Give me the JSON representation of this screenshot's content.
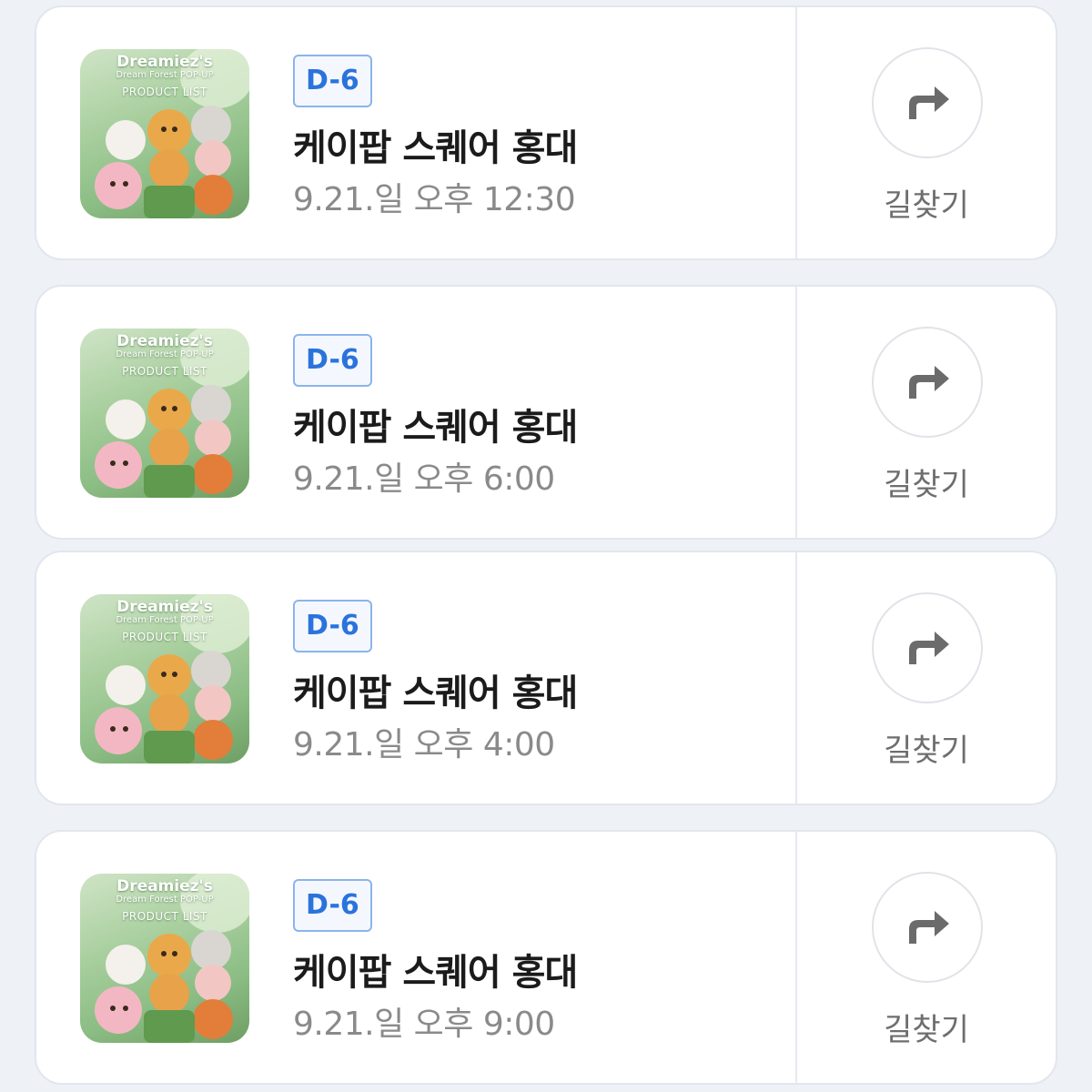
{
  "items": [
    {
      "thumb": {
        "title": "Dreamiez's",
        "subtitle": "Dream Forest POP-UP",
        "list_label": "PRODUCT LIST"
      },
      "badge": "D-6",
      "venue": "케이팝 스퀘어 홍대",
      "datetime": "9.21.일 오후 12:30",
      "action_label": "길찾기",
      "action_icon": "turn-right-arrow-icon"
    },
    {
      "thumb": {
        "title": "Dreamiez's",
        "subtitle": "Dream Forest POP-UP",
        "list_label": "PRODUCT LIST"
      },
      "badge": "D-6",
      "venue": "케이팝 스퀘어 홍대",
      "datetime": "9.21.일 오후 6:00",
      "action_label": "길찾기",
      "action_icon": "turn-right-arrow-icon"
    },
    {
      "thumb": {
        "title": "Dreamiez's",
        "subtitle": "Dream Forest POP-UP",
        "list_label": "PRODUCT LIST"
      },
      "badge": "D-6",
      "venue": "케이팝 스퀘어 홍대",
      "datetime": "9.21.일 오후 4:00",
      "action_label": "길찾기",
      "action_icon": "turn-right-arrow-icon"
    },
    {
      "thumb": {
        "title": "Dreamiez's",
        "subtitle": "Dream Forest POP-UP",
        "list_label": "PRODUCT LIST"
      },
      "badge": "D-6",
      "venue": "케이팝 스퀘어 홍대",
      "datetime": "9.21.일 오후 9:00",
      "action_label": "길찾기",
      "action_icon": "turn-right-arrow-icon"
    }
  ],
  "colors": {
    "badge_text": "#2b73dc",
    "badge_border": "#8bb4ec",
    "venue_text": "#1b1b1b",
    "datetime_text": "#8a8a8a",
    "icon": "#6b6b6b",
    "background": "#eef1f6"
  }
}
